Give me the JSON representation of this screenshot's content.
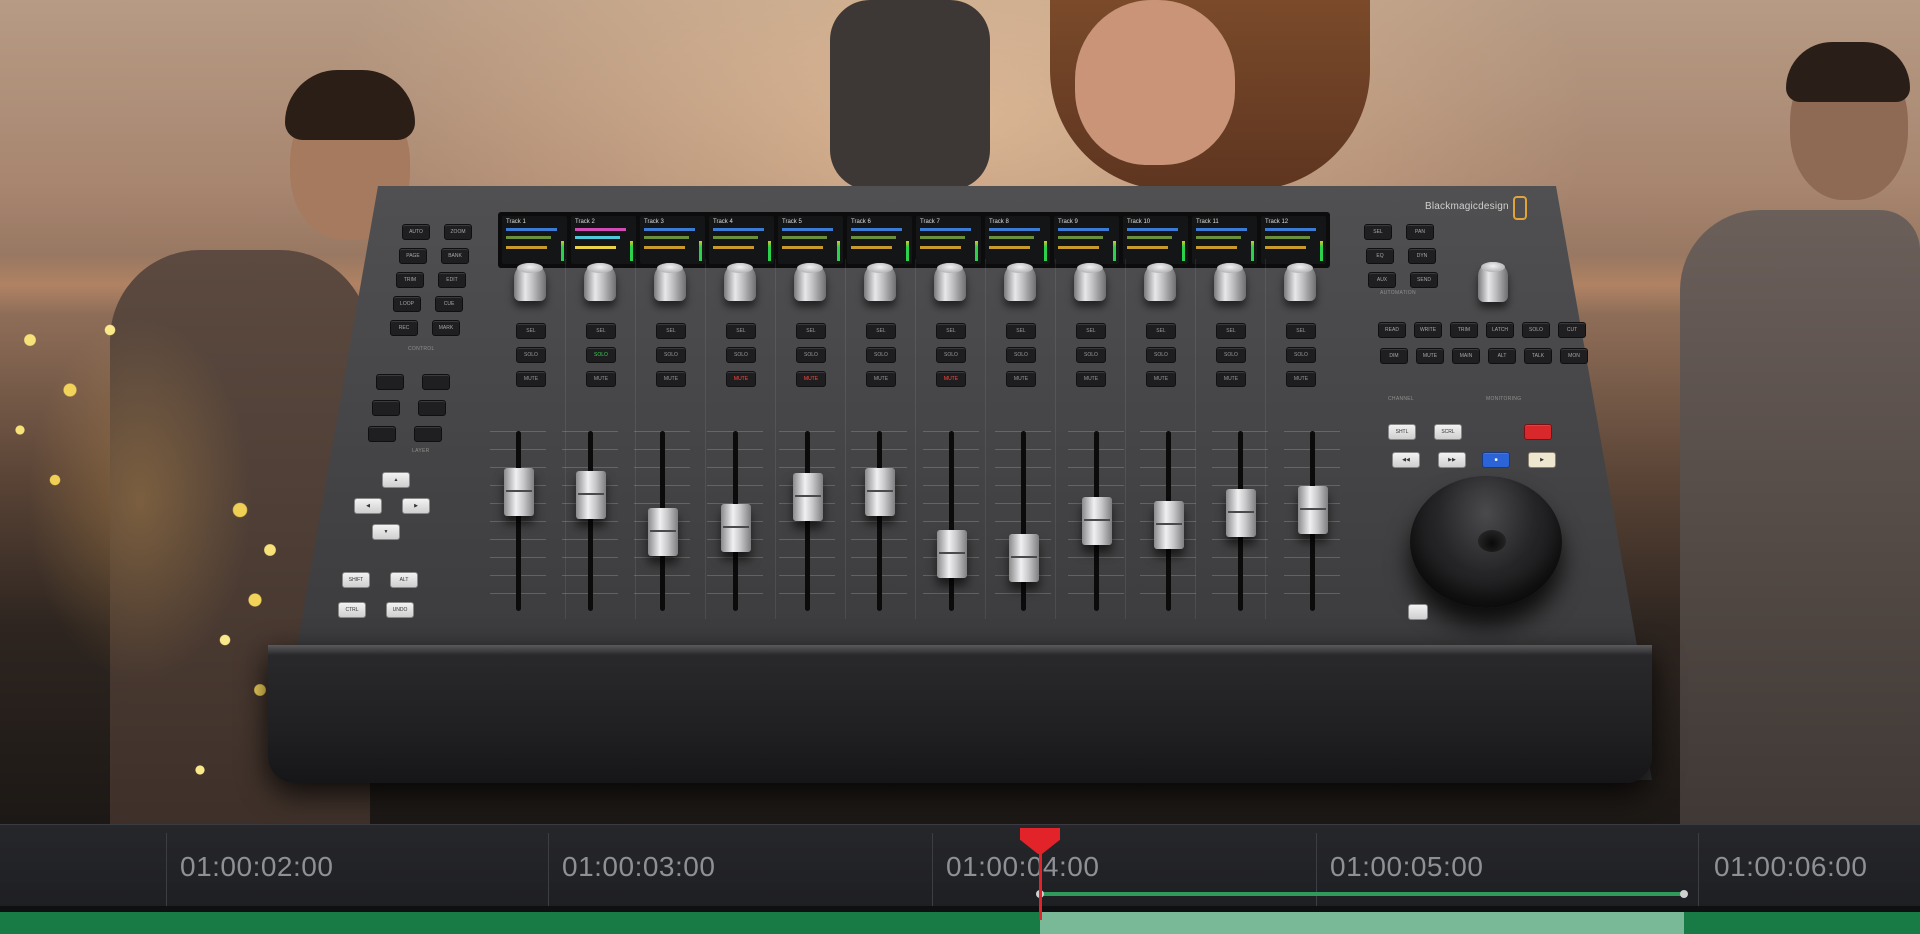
{
  "scene": {
    "description_icon": "photo-background"
  },
  "console": {
    "brand": "Blackmagicdesign",
    "tracks": [
      {
        "name": "Track 1",
        "solo": false,
        "mute": false,
        "fader": 0.72
      },
      {
        "name": "Track 2",
        "solo": true,
        "mute": false,
        "fader": 0.7
      },
      {
        "name": "Track 3",
        "solo": false,
        "mute": false,
        "fader": 0.42
      },
      {
        "name": "Track 4",
        "solo": false,
        "mute": true,
        "fader": 0.45
      },
      {
        "name": "Track 5",
        "solo": false,
        "mute": true,
        "fader": 0.68
      },
      {
        "name": "Track 6",
        "solo": false,
        "mute": false,
        "fader": 0.72
      },
      {
        "name": "Track 7",
        "solo": false,
        "mute": true,
        "fader": 0.25
      },
      {
        "name": "Track 8",
        "solo": false,
        "mute": false,
        "fader": 0.22
      },
      {
        "name": "Track 9",
        "solo": false,
        "mute": false,
        "fader": 0.5
      },
      {
        "name": "Track 10",
        "solo": false,
        "mute": false,
        "fader": 0.47
      },
      {
        "name": "Track 11",
        "solo": false,
        "mute": false,
        "fader": 0.56
      },
      {
        "name": "Track 12",
        "solo": false,
        "mute": false,
        "fader": 0.58
      }
    ],
    "channel_buttons": {
      "sel": "SEL",
      "solo": "SOLO",
      "mute": "MUTE"
    },
    "left_panel": {
      "control_buttons": [
        "AUTO",
        "ZOOM",
        "PAGE",
        "BANK",
        "TRIM",
        "EDIT",
        "LOOP",
        "CUE",
        "REC",
        "MARK"
      ],
      "control_label": "CONTROL",
      "layer_label": "LAYER",
      "nav_buttons": [
        "▲",
        "◀",
        "▶",
        "▼"
      ],
      "mod_buttons": [
        "SHIFT",
        "ALT",
        "CTRL",
        "UNDO"
      ]
    },
    "right_panel": {
      "top_buttons": [
        "SEL",
        "PAN",
        "EQ",
        "DYN",
        "AUX",
        "SEND"
      ],
      "automation_label": "AUTOMATION",
      "grid_buttons": [
        "READ",
        "WRITE",
        "TRIM",
        "LATCH",
        "SOLO",
        "CUT",
        "DIM",
        "MUTE",
        "MAIN",
        "ALT",
        "TALK",
        "MON"
      ],
      "channel_label": "CHANNEL",
      "monitoring_label": "MONITORING",
      "transport": {
        "buttons": [
          "SHTL",
          "SCRL"
        ]
      }
    }
  },
  "timeline": {
    "timecodes": [
      "01:00:02:00",
      "01:00:03:00",
      "01:00:04:00",
      "01:00:05:00",
      "01:00:06:00"
    ],
    "colors": {
      "playhead": "#e3232a",
      "clip": "#187a45",
      "clip_selected": "#7ab997",
      "range": "#2f9a5c"
    }
  }
}
